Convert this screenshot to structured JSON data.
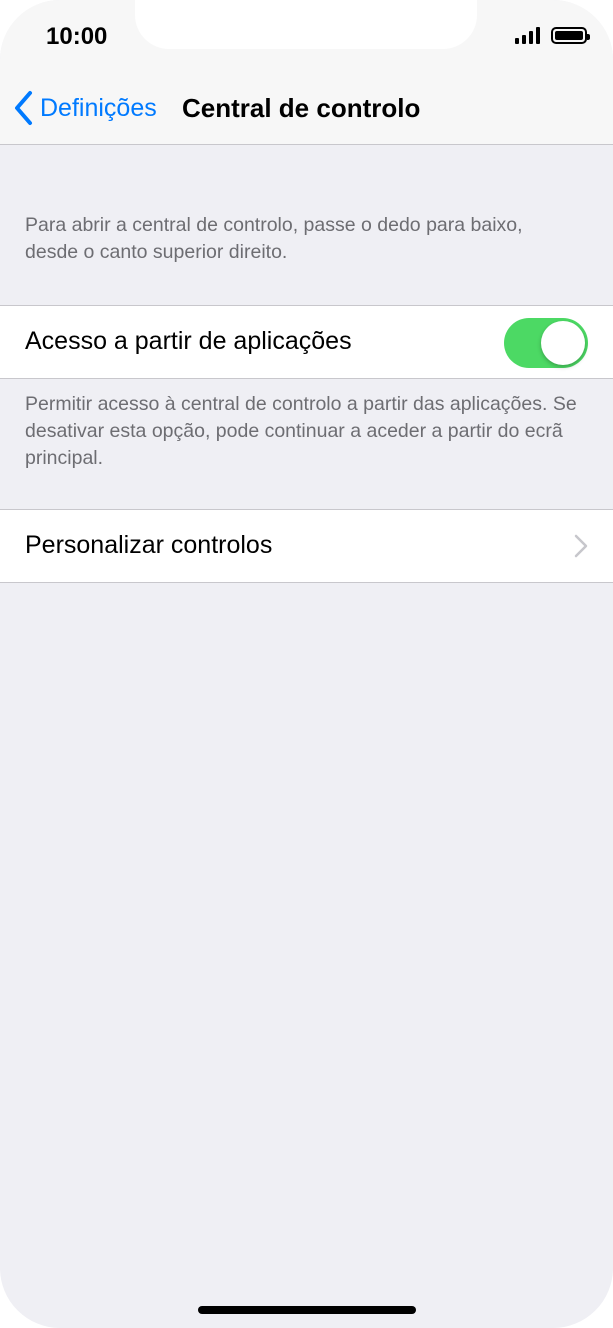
{
  "status_bar": {
    "time": "10:00"
  },
  "nav": {
    "back_label": "Definições",
    "title": "Central de controlo"
  },
  "header_description": "Para abrir a central de controlo, passe o dedo para baixo, desde o canto superior direito.",
  "access_row": {
    "label": "Acesso a partir de aplicações",
    "toggle_on": true
  },
  "access_description": "Permitir acesso à central de controlo a partir das aplicações. Se desativar esta opção, pode continuar a aceder a partir do ecrã principal.",
  "customize_row": {
    "label": "Personalizar controlos"
  },
  "colors": {
    "accent": "#007aff",
    "toggle_on": "#4cd964",
    "background": "#efeff4"
  },
  "icons": [
    "signal-icon",
    "battery-icon",
    "back-chevron-icon",
    "chevron-right-icon"
  ]
}
